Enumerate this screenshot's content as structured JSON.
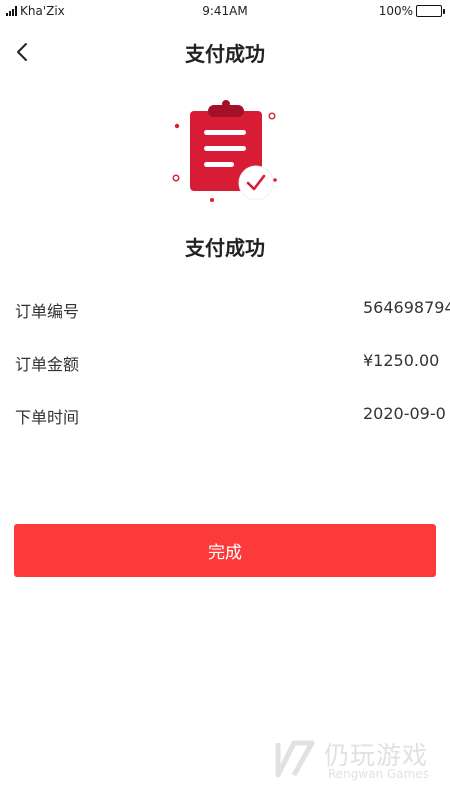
{
  "status_bar": {
    "carrier": "Kha'Zix",
    "time": "9:41AM",
    "battery": "100%",
    "battery_level": 1.0
  },
  "header": {
    "title": "支付成功"
  },
  "result": {
    "title": "支付成功",
    "icon": "clipboard-check-icon"
  },
  "order_info": [
    {
      "label": "订单编号",
      "value": "564698794"
    },
    {
      "label": "订单金额",
      "value": "¥1250.00"
    },
    {
      "label": "下单时间",
      "value": "2020-09-0"
    }
  ],
  "actions": {
    "done_label": "完成"
  },
  "watermark": {
    "text": "仍玩游戏",
    "sub": "Rengwan Games"
  },
  "colors": {
    "accent": "#fd3a3a",
    "icon_red": "#d91c35"
  }
}
